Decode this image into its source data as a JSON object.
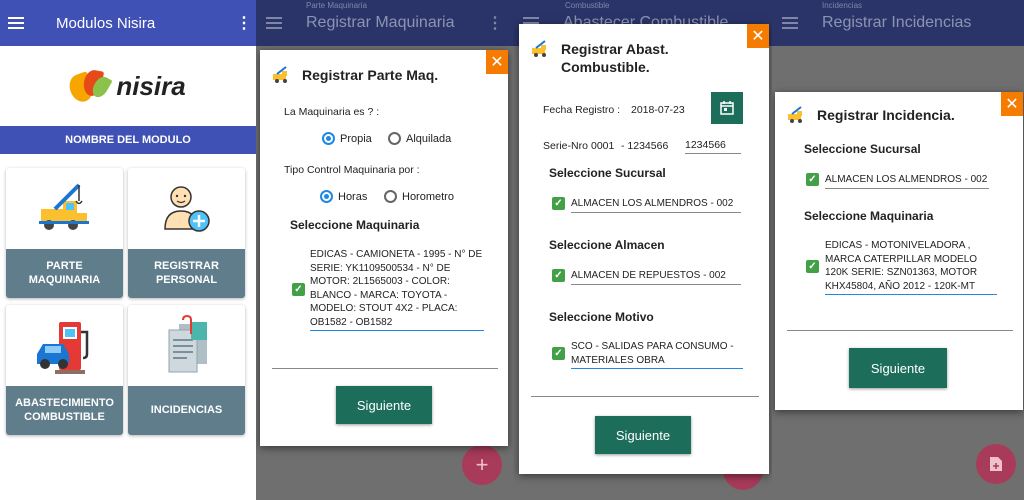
{
  "screen1": {
    "title": "Modulos Nisira",
    "logo_text": "nisira",
    "module_header": "NOMBRE DEL MODULO",
    "tiles": [
      {
        "label": "PARTE MAQUINARIA",
        "icon": "tow-truck-icon"
      },
      {
        "label": "REGISTRAR PERSONAL",
        "icon": "add-person-icon"
      },
      {
        "label": "ABASTECIMIENTO COMBUSTIBLE",
        "icon": "fuel-pump-icon"
      },
      {
        "label": "INCIDENCIAS",
        "icon": "clipboard-icon"
      }
    ]
  },
  "screen2": {
    "bg_sub": "Parte Maquinaria",
    "bg_title": "Registrar Maquinaria",
    "dialog_title": "Registrar Parte Maq.",
    "q1": "La Maquinaria es ? :",
    "opt_propia": "Propia",
    "opt_alquilada": "Alquilada",
    "q2": "Tipo Control Maquinaria por :",
    "opt_horas": "Horas",
    "opt_horometro": "Horometro",
    "sel_label": "Seleccione Maquinaria",
    "maquinaria_value": "EDICAS - CAMIONETA - 1995 - N° DE SERIE: YK1109500534 - N° DE MOTOR: 2L1565003 - COLOR: BLANCO - MARCA: TOYOTA - MODELO: STOUT 4X2 - PLACA: OB1582 - OB1582",
    "button": "Siguiente",
    "fab": "+"
  },
  "screen3": {
    "bg_sub": "Combustible",
    "bg_title": "Abastecer Combustible",
    "dialog_title_1": "Registrar Abast.",
    "dialog_title_2": "Combustible.",
    "fecha_label": "Fecha Registro :",
    "fecha_value": "2018-07-23",
    "serie_label": "Serie-Nro",
    "serie_value": "0001",
    "nro_value": "- 1234566",
    "nro_input": "1234566",
    "sucursal_label": "Seleccione Sucursal",
    "sucursal_value": "ALMACEN LOS ALMENDROS - 002",
    "almacen_label": "Seleccione Almacen",
    "almacen_value": "ALMACEN DE REPUESTOS - 002",
    "motivo_label": "Seleccione Motivo",
    "motivo_value": "SCO - SALIDAS PARA CONSUMO - MATERIALES OBRA",
    "button": "Siguiente"
  },
  "screen4": {
    "bg_sub": "Incidencias",
    "bg_title": "Registrar Incidencias",
    "dialog_title": "Registrar Incidencia.",
    "sucursal_label": "Seleccione Sucursal",
    "sucursal_value": "ALMACEN LOS ALMENDROS - 002",
    "maquinaria_label": "Seleccione Maquinaria",
    "maquinaria_value": "EDICAS - MOTONIVELADORA , MARCA CATERPILLAR MODELO 120K SERIE: SZN01363, MOTOR KHX45804, AÑO 2012 - 120K-MT",
    "button": "Siguiente"
  },
  "colors": {
    "primary": "#3f51b5",
    "tile_label": "#607d8b",
    "accent_green": "#1c6e5a",
    "close_orange": "#f57c00",
    "check_green": "#43a047"
  }
}
